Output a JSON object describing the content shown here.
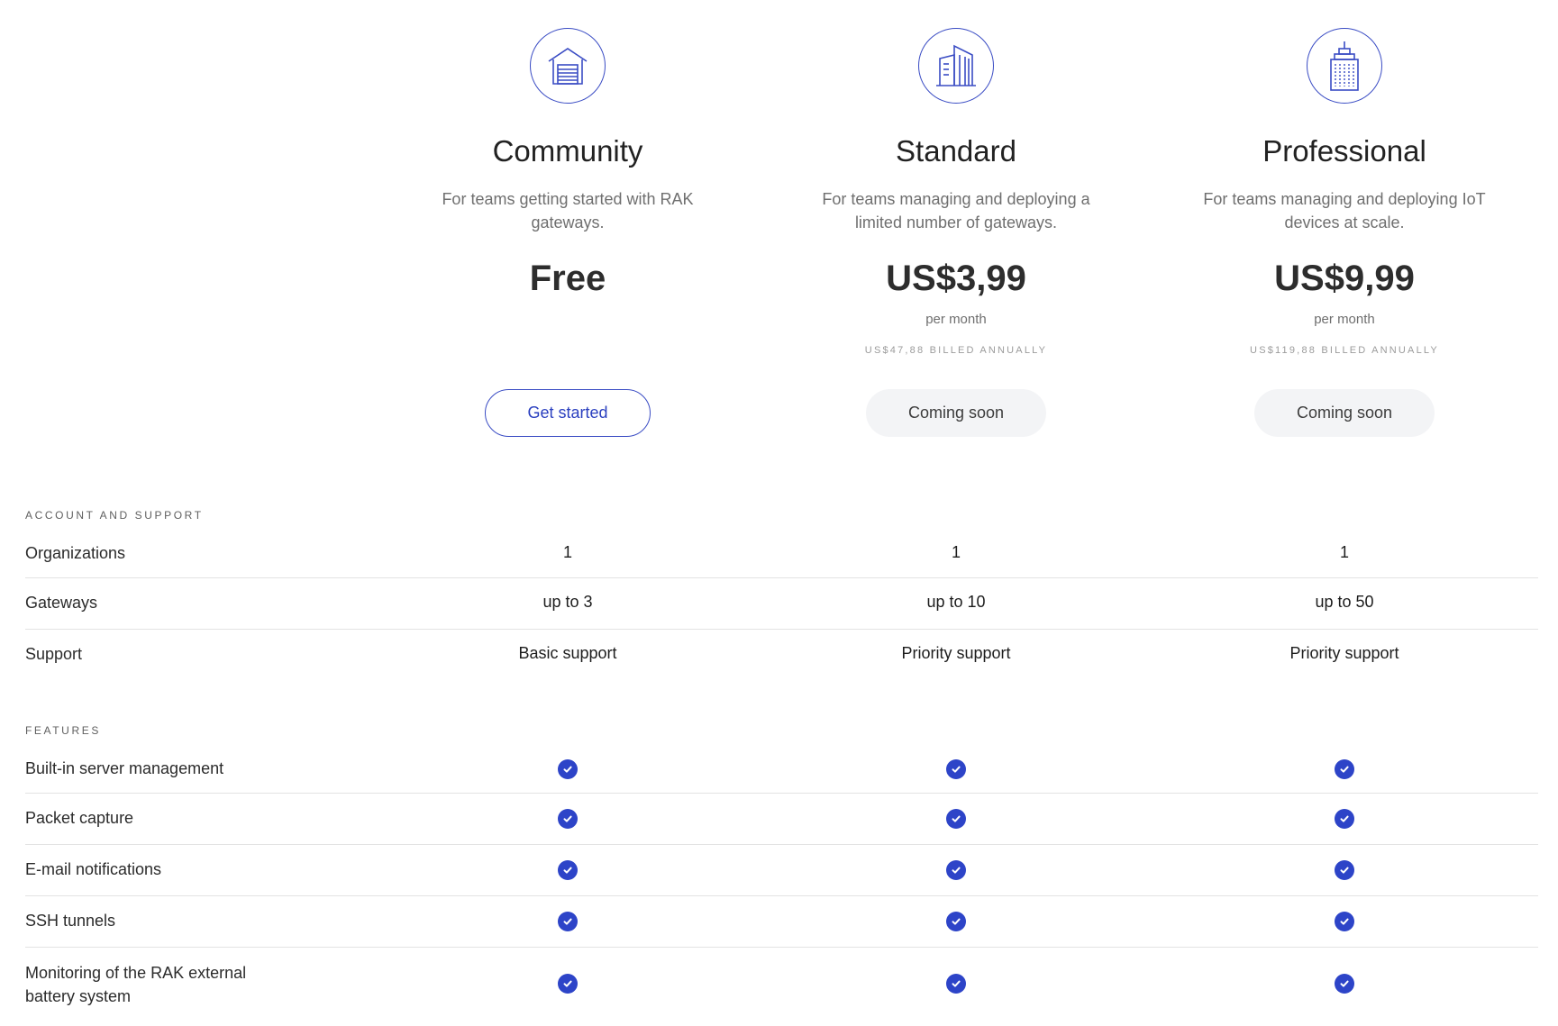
{
  "colors": {
    "accent": "#2d44c8",
    "muted_button_bg": "#f3f4f6",
    "divider": "#e3e3e3"
  },
  "plans": [
    {
      "icon": "garage-icon",
      "name": "Community",
      "description": "For teams getting started with RAK gateways.",
      "price": "Free",
      "per": "",
      "billed": "",
      "button_label": "Get started"
    },
    {
      "icon": "office-building-icon",
      "name": "Standard",
      "description": "For teams managing and deploying a limited number of gateways.",
      "price": "US$3,99",
      "per": "per month",
      "billed": "US$47,88 BILLED ANNUALLY",
      "button_label": "Coming soon"
    },
    {
      "icon": "skyscraper-icon",
      "name": "Professional",
      "description": "For teams managing and deploying IoT devices at scale.",
      "price": "US$9,99",
      "per": "per month",
      "billed": "US$119,88 BILLED ANNUALLY",
      "button_label": "Coming soon"
    }
  ],
  "account_section": {
    "label": "ACCOUNT AND SUPPORT",
    "rows": [
      {
        "label": "Organizations",
        "values": [
          "1",
          "1",
          "1"
        ]
      },
      {
        "label": "Gateways",
        "values": [
          "up to 3",
          "up to 10",
          "up to 50"
        ]
      },
      {
        "label": "Support",
        "values": [
          "Basic support",
          "Priority support",
          "Priority support"
        ]
      }
    ]
  },
  "features_section": {
    "label": "FEATURES",
    "rows": [
      {
        "label": "Built-in server management",
        "included": [
          true,
          true,
          true
        ]
      },
      {
        "label": "Packet capture",
        "included": [
          true,
          true,
          true
        ]
      },
      {
        "label": "E-mail notifications",
        "included": [
          true,
          true,
          true
        ]
      },
      {
        "label": "SSH tunnels",
        "included": [
          true,
          true,
          true
        ]
      },
      {
        "label": "Monitoring of the RAK external battery system",
        "included": [
          true,
          true,
          true
        ]
      }
    ]
  }
}
